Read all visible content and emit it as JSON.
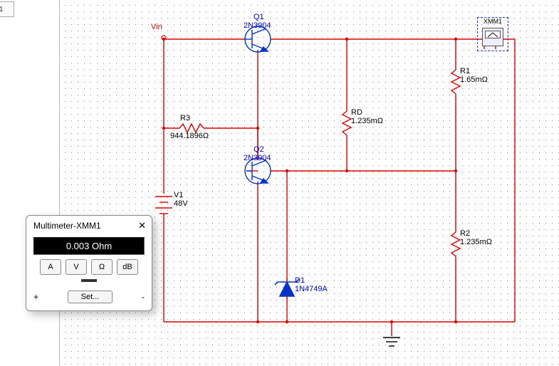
{
  "tab_stub": "1",
  "vin_label": "Vin",
  "components": {
    "Q1": {
      "ref": "Q1",
      "value": "2N3904"
    },
    "Q2": {
      "ref": "Q2",
      "value": "2N3904"
    },
    "R1": {
      "ref": "R1",
      "value": "1.65mΩ"
    },
    "R2": {
      "ref": "R2",
      "value": "1.235mΩ"
    },
    "R3": {
      "ref": "R3",
      "value": "944.1896Ω"
    },
    "RD": {
      "ref": "RD",
      "value": "1.235mΩ"
    },
    "V1": {
      "ref": "V1",
      "value": "48V"
    },
    "D1": {
      "ref": "D1",
      "value": "1N4749A"
    }
  },
  "instrument": {
    "name": "XMM1"
  },
  "multimeter": {
    "title": "Multimeter-XMM1",
    "reading": "0.003 Ohm",
    "buttons": {
      "a": "A",
      "v": "V",
      "ohm": "Ω",
      "db": "dB"
    },
    "set": "Set...",
    "plus": "+",
    "minus": "-"
  }
}
